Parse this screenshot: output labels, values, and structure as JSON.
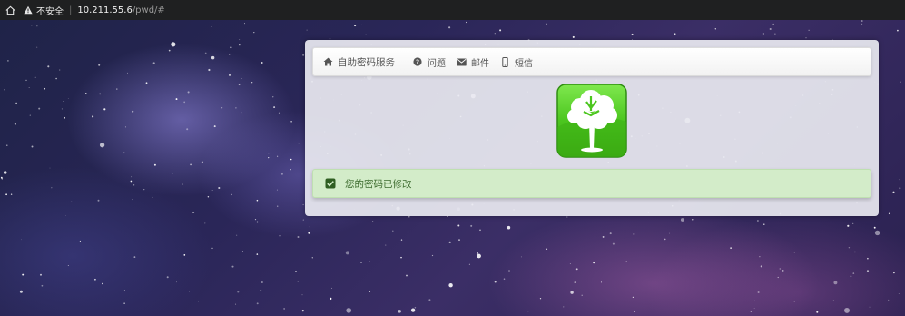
{
  "browser": {
    "security_label": "不安全",
    "url_host": "10.211.55.6",
    "url_path": "/pwd/#"
  },
  "nav": {
    "items": [
      {
        "label": "自助密码服务",
        "icon": "home-icon"
      },
      {
        "label": "问题",
        "icon": "question-circle-icon"
      },
      {
        "label": "邮件",
        "icon": "envelope-icon"
      },
      {
        "label": "短信",
        "icon": "mobile-icon"
      }
    ]
  },
  "alert": {
    "message": "您的密码已修改",
    "icon": "check-square-icon",
    "color": "#d3ecc9"
  },
  "colors": {
    "logo_green": "#5ad12f",
    "alert_text": "#3c6b2e"
  }
}
